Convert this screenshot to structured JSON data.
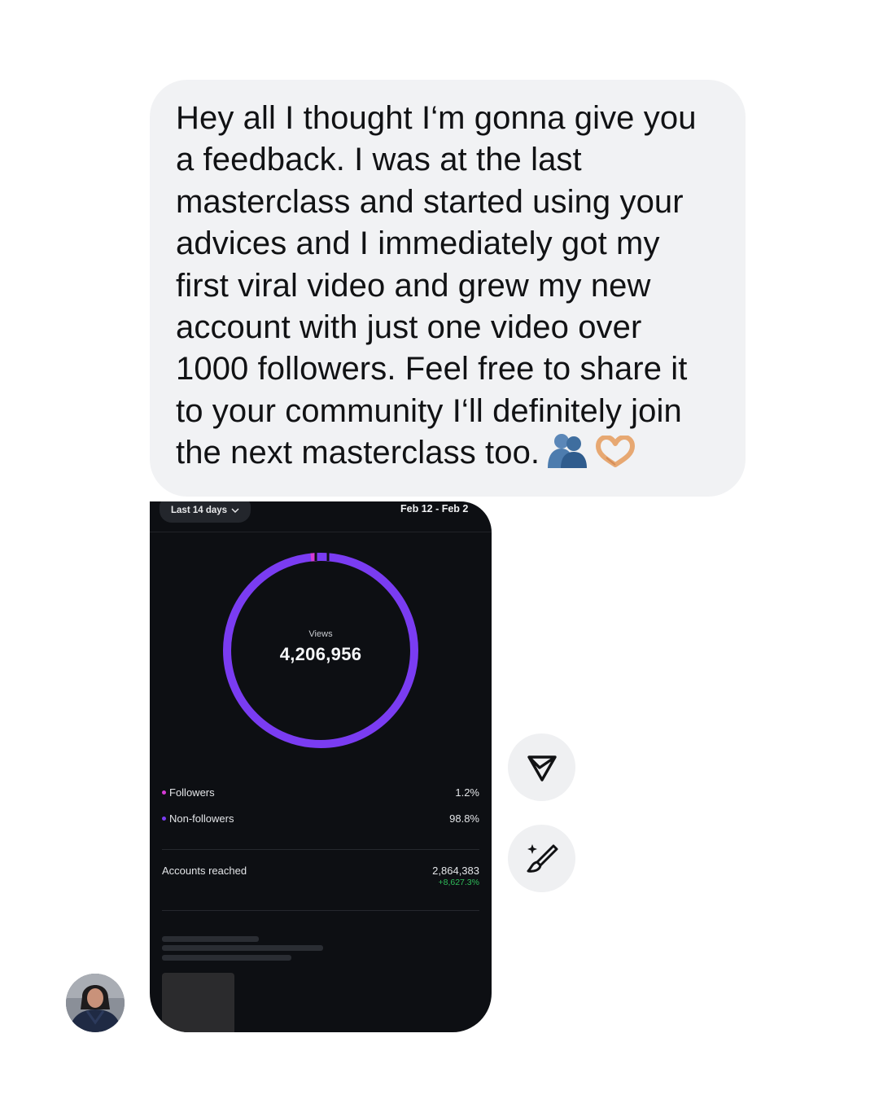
{
  "message": {
    "text": "Hey all I thought I‘m gonna give you a feedback. I was at the last masterclass and started using your advices and I immediately got my first viral video and grew my new account with just one video over 1000 followers. Feel free to share it to your community I‘ll definitely join the next masterclass too.",
    "emojis": [
      "people-hugging-emoji",
      "heart-hands-emoji"
    ]
  },
  "insights": {
    "range_label": "Last 14 days",
    "date_range": "Feb 12 - Feb 2",
    "views_label": "Views",
    "views_value": "4,206,956",
    "followers_share": 0.012,
    "legend": [
      {
        "label": "Followers",
        "value": "1.2%",
        "color": "#d63ad6"
      },
      {
        "label": "Non-followers",
        "value": "98.8%",
        "color": "#7a3cf2"
      }
    ],
    "accounts_reached_label": "Accounts reached",
    "accounts_reached_value": "2,864,383",
    "accounts_reached_delta": "+8,627.3%"
  },
  "actions": {
    "share_icon": "send-icon",
    "edit_icon": "magic-brush-icon"
  },
  "colors": {
    "bubble_bg": "#f1f2f4",
    "card_bg": "#0d0f13",
    "ring_primary": "#7a3cf2",
    "ring_secondary": "#d63ad6",
    "delta_green": "#2fbe5a"
  }
}
